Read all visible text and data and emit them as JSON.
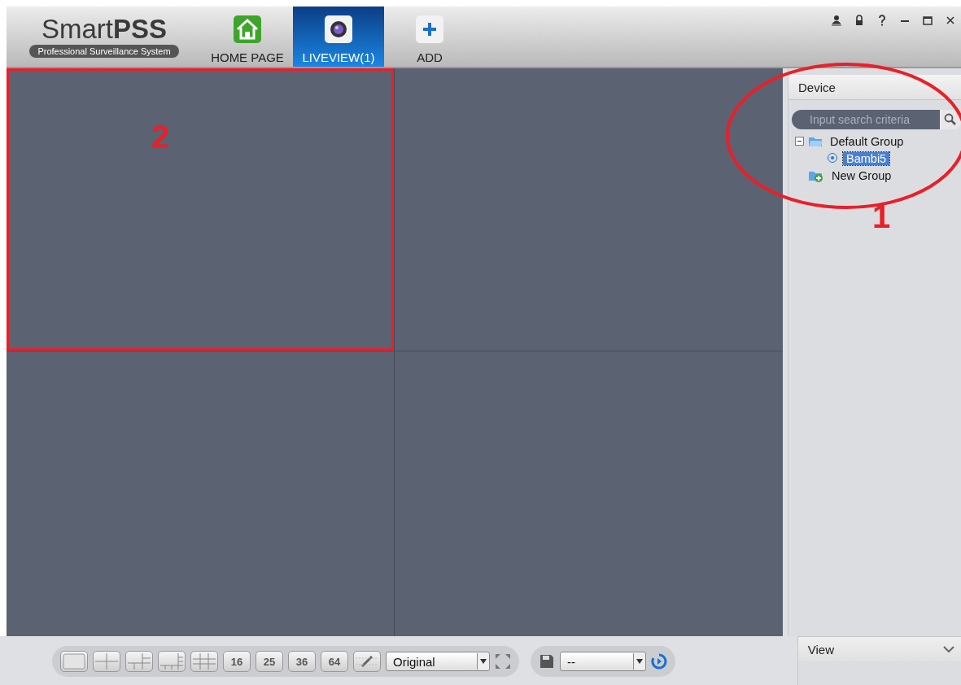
{
  "app": {
    "logo_light": "Smart",
    "logo_bold": "PSS",
    "tagline": "Professional Surveillance System"
  },
  "tabs": [
    {
      "kind": "home",
      "label": "HOME PAGE",
      "selected": false
    },
    {
      "kind": "camera",
      "label": "LIVEVIEW(1)",
      "selected": true
    },
    {
      "kind": "add",
      "label": "ADD",
      "selected": false
    }
  ],
  "window_controls": [
    {
      "kind": "user"
    },
    {
      "kind": "lock"
    },
    {
      "kind": "help"
    },
    {
      "kind": "minimize"
    },
    {
      "kind": "maximize"
    },
    {
      "kind": "close"
    }
  ],
  "sidebar": {
    "title": "Device",
    "search": {
      "placeholder": "Input search criteria"
    },
    "tree": [
      {
        "kind": "group",
        "label": "Default Group",
        "expanded": true,
        "children": [
          {
            "kind": "device",
            "label": "Bambi5",
            "selected": true
          }
        ]
      },
      {
        "kind": "new-group",
        "label": "New Group"
      }
    ],
    "footer": "View"
  },
  "toolbar": {
    "layouts": [
      {
        "kind": "single"
      },
      {
        "kind": "quad"
      },
      {
        "kind": "six"
      },
      {
        "kind": "eight"
      },
      {
        "kind": "nine"
      },
      {
        "kind": "numbered",
        "label": "16"
      },
      {
        "kind": "numbered",
        "label": "25"
      },
      {
        "kind": "numbered",
        "label": "36"
      },
      {
        "kind": "numbered",
        "label": "64"
      },
      {
        "kind": "custom"
      }
    ],
    "scale": "Original",
    "view": "--"
  },
  "annotations": [
    {
      "kind": "ellipse",
      "label": "1"
    },
    {
      "kind": "rectangle",
      "label": "2"
    }
  ]
}
